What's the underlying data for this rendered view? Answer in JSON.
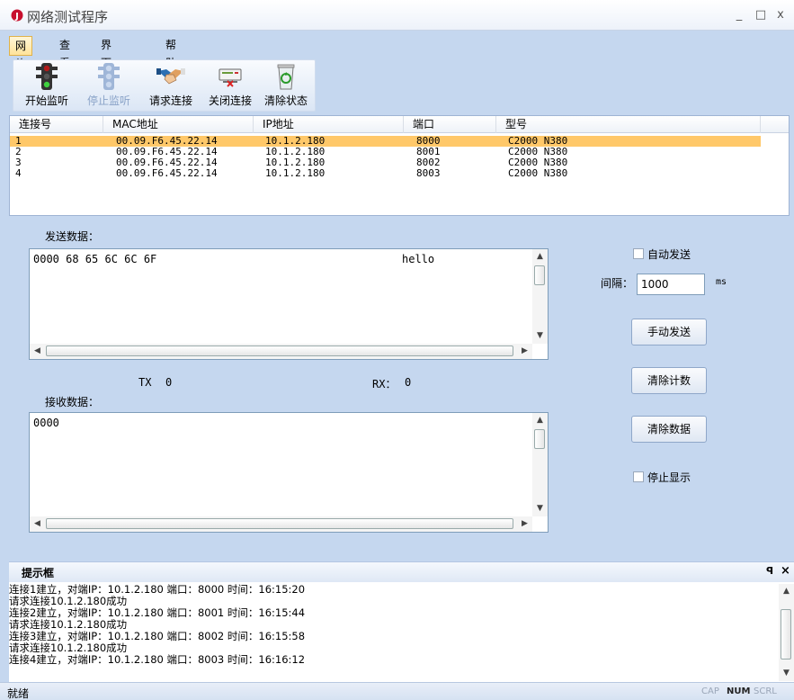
{
  "window": {
    "title": "网络测试程序",
    "minimize": "_",
    "maximize": "□",
    "close": "x"
  },
  "menu": [
    "网络",
    "查看",
    "界面风格",
    "帮助"
  ],
  "toolbar": {
    "start_listen": "开始监听",
    "stop_listen": "停止监听",
    "request_connect": "请求连接",
    "close_connect": "关闭连接",
    "clear_status": "清除状态"
  },
  "connections": {
    "headers": [
      "连接号",
      "MAC地址",
      "IP地址",
      "端口",
      "型号"
    ],
    "rows": [
      [
        "1",
        "00.09.F6.45.22.14",
        "10.1.2.180",
        "8000",
        "C2000 N380"
      ],
      [
        "2",
        "00.09.F6.45.22.14",
        "10.1.2.180",
        "8001",
        "C2000 N380"
      ],
      [
        "3",
        "00.09.F6.45.22.14",
        "10.1.2.180",
        "8002",
        "C2000 N380"
      ],
      [
        "4",
        "00.09.F6.45.22.14",
        "10.1.2.180",
        "8003",
        "C2000 N380"
      ]
    ]
  },
  "send": {
    "label": "发送数据：",
    "hex": "0000 68 65 6C 6C 6F",
    "ascii": "hello",
    "tx_label": "TX",
    "tx_value": "0",
    "rx_label": "RX：",
    "rx_value": "0"
  },
  "receive": {
    "label": "接收数据：",
    "content": "0000"
  },
  "controls": {
    "auto_send": "自动发送",
    "interval_label": "间隔：",
    "interval_value": "1000",
    "interval_unit": "ms",
    "manual_send": "手动发送",
    "clear_count": "清除计数",
    "clear_data": "清除数据",
    "stop_display": "停止显示"
  },
  "prompt": {
    "title": "提示框",
    "pin": "ꟼ",
    "close": "×",
    "lines": [
      "连接1建立，对端IP：10.1.2.180  端口：8000  时间：16:15:20",
      "请求连接10.1.2.180成功",
      "连接2建立，对端IP：10.1.2.180  端口：8001  时间：16:15:44",
      "请求连接10.1.2.180成功",
      "连接3建立，对端IP：10.1.2.180  端口：8002  时间：16:15:58",
      "请求连接10.1.2.180成功",
      "连接4建立，对端IP：10.1.2.180  端口：8003  时间：16:16:12"
    ]
  },
  "statusbar": {
    "text": "就绪",
    "cap": "CAP",
    "num": "NUM",
    "scrl": "SCRL"
  }
}
